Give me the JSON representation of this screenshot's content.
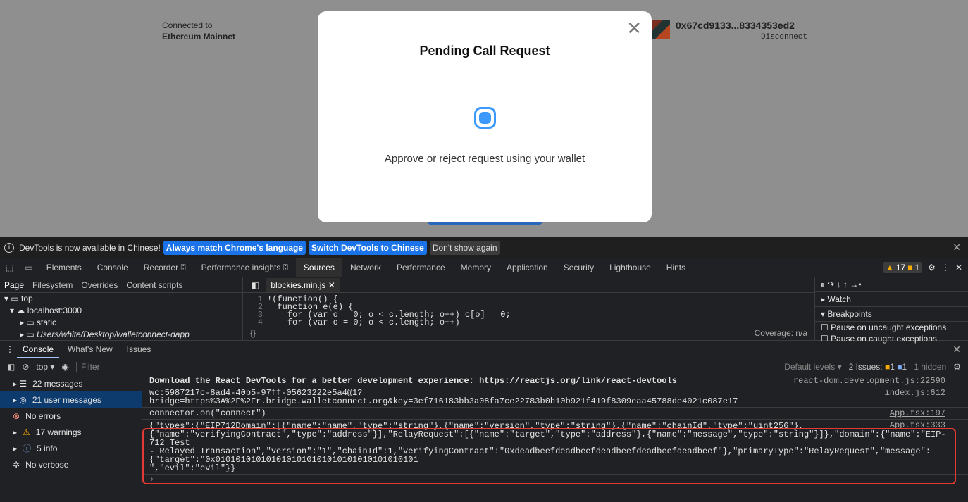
{
  "app": {
    "connected_label": "Connected to",
    "network": "Ethereum Mainnet",
    "address": "0x67cd9133...8334353ed2",
    "disconnect": "Disconnect"
  },
  "modal": {
    "title": "Pending Call Request",
    "message": "Approve or reject request using your wallet",
    "close": "✕"
  },
  "infobar": {
    "text": "DevTools is now available in Chinese!",
    "btn1": "Always match Chrome's language",
    "btn2": "Switch DevTools to Chinese",
    "btn3": "Don't show again"
  },
  "tabs": [
    "Elements",
    "Console",
    "Recorder ⍠",
    "Performance insights ⍠",
    "Sources",
    "Network",
    "Performance",
    "Memory",
    "Application",
    "Security",
    "Lighthouse",
    "Hints"
  ],
  "tab_badges": {
    "warnings": "17",
    "errors": "1"
  },
  "sources": {
    "nav_tabs": [
      "Page",
      "Filesystem",
      "Overrides",
      "Content scripts"
    ],
    "tree": [
      "top",
      "localhost:3000",
      "static",
      "Users/white/Desktop/walletconnect-dapp"
    ],
    "file": "blockies.min.js",
    "coverage": "Coverage: n/a",
    "watch": "Watch",
    "breakpoints": "Breakpoints",
    "chk1": "Pause on uncaught exceptions",
    "chk2": "Pause on caught exceptions",
    "code": [
      "!(function() {",
      "function e(e) {",
      "for (var o = 0; o < c.length; o++) c[o] = 0;",
      "for (var o = 0; o < c.length; o++)"
    ]
  },
  "drawer": {
    "tabs": [
      "Console",
      "What's New",
      "Issues"
    ]
  },
  "console_toolbar": {
    "context": "top",
    "filter": "Filter",
    "levels": "Default levels",
    "issues": "2 Issues:",
    "issues_warn": "1",
    "issues_info": "1",
    "hidden": "1 hidden"
  },
  "sidebar": [
    "22 messages",
    "21 user messages",
    "No errors",
    "17 warnings",
    "5 info",
    "No verbose"
  ],
  "messages": [
    {
      "text": "Download the React DevTools for a better development experience: ",
      "link": "https://reactjs.org/link/react-devtools",
      "src": "react-dom.development.js:22590"
    },
    {
      "text": "wc:5987217c-8ad4-40b5-97ff-05623222e5a4@1?\nbridge=https%3A%2F%2Fr.bridge.walletconnect.org&key=3ef716183bb3a08fa7ce22783b0b10b921f419f8309eaa45788de4021c087e17",
      "src": "index.js:612"
    },
    {
      "text": "connector.on(\"connect\")",
      "src": "App.tsx:197"
    },
    {
      "text": "{\"types\":{\"EIP712Domain\":[{\"name\":\"name\",\"type\":\"string\"},{\"name\":\"version\",\"type\":\"string\"},{\"name\":\"chainId\",\"type\":\"uint256\"},\n{\"name\":\"verifyingContract\",\"type\":\"address\"}],\"RelayRequest\":[{\"name\":\"target\",\"type\":\"address\"},{\"name\":\"message\",\"type\":\"string\"}]},\"domain\":{\"name\":\"EIP-712 Test\n- Relayed Transaction\",\"version\":\"1\",\"chainId\":1,\"verifyingContract\":\"0xdeadbeefdeadbeefdeadbeefdeadbeefdeadbeef\"},\"primaryType\":\"RelayRequest\",\"message\":\n{\"target\":\"0x0101010101010101010101010101010101010101\n\",\"evil\":\"evil\"}}",
      "src": "App.tsx:333"
    }
  ]
}
